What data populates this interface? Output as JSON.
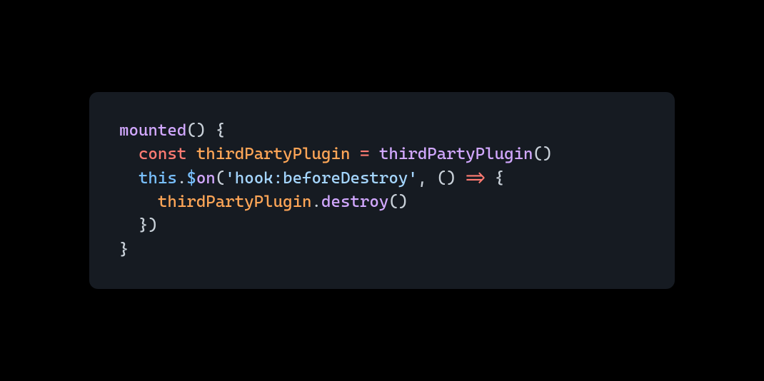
{
  "code": {
    "line1": {
      "fn": "mounted",
      "open_paren": "(",
      "close_paren": ")",
      "space": " ",
      "open_brace": "{"
    },
    "line2": {
      "indent": "  ",
      "kw": "const",
      "space1": " ",
      "var": "thirdPartyPlugin",
      "space2": " ",
      "op": "=",
      "space3": " ",
      "call": "thirdPartyPlugin",
      "open_paren": "(",
      "close_paren": ")"
    },
    "line3": {
      "indent": "  ",
      "this": "this",
      "dot": ".",
      "dollar": "$",
      "method": "on",
      "open_paren": "(",
      "str": "'hook:beforeDestroy'",
      "comma": ",",
      "space": " ",
      "open_paren2": "(",
      "close_paren2": ")",
      "space2": " ",
      "arrow": "=>",
      "space3": " ",
      "open_brace": "{"
    },
    "line4": {
      "indent": "    ",
      "obj": "thirdPartyPlugin",
      "dot": ".",
      "method": "destroy",
      "open_paren": "(",
      "close_paren": ")"
    },
    "line5": {
      "indent": "  ",
      "close_brace": "}",
      "close_paren": ")"
    },
    "line6": {
      "close_brace": "}"
    }
  }
}
